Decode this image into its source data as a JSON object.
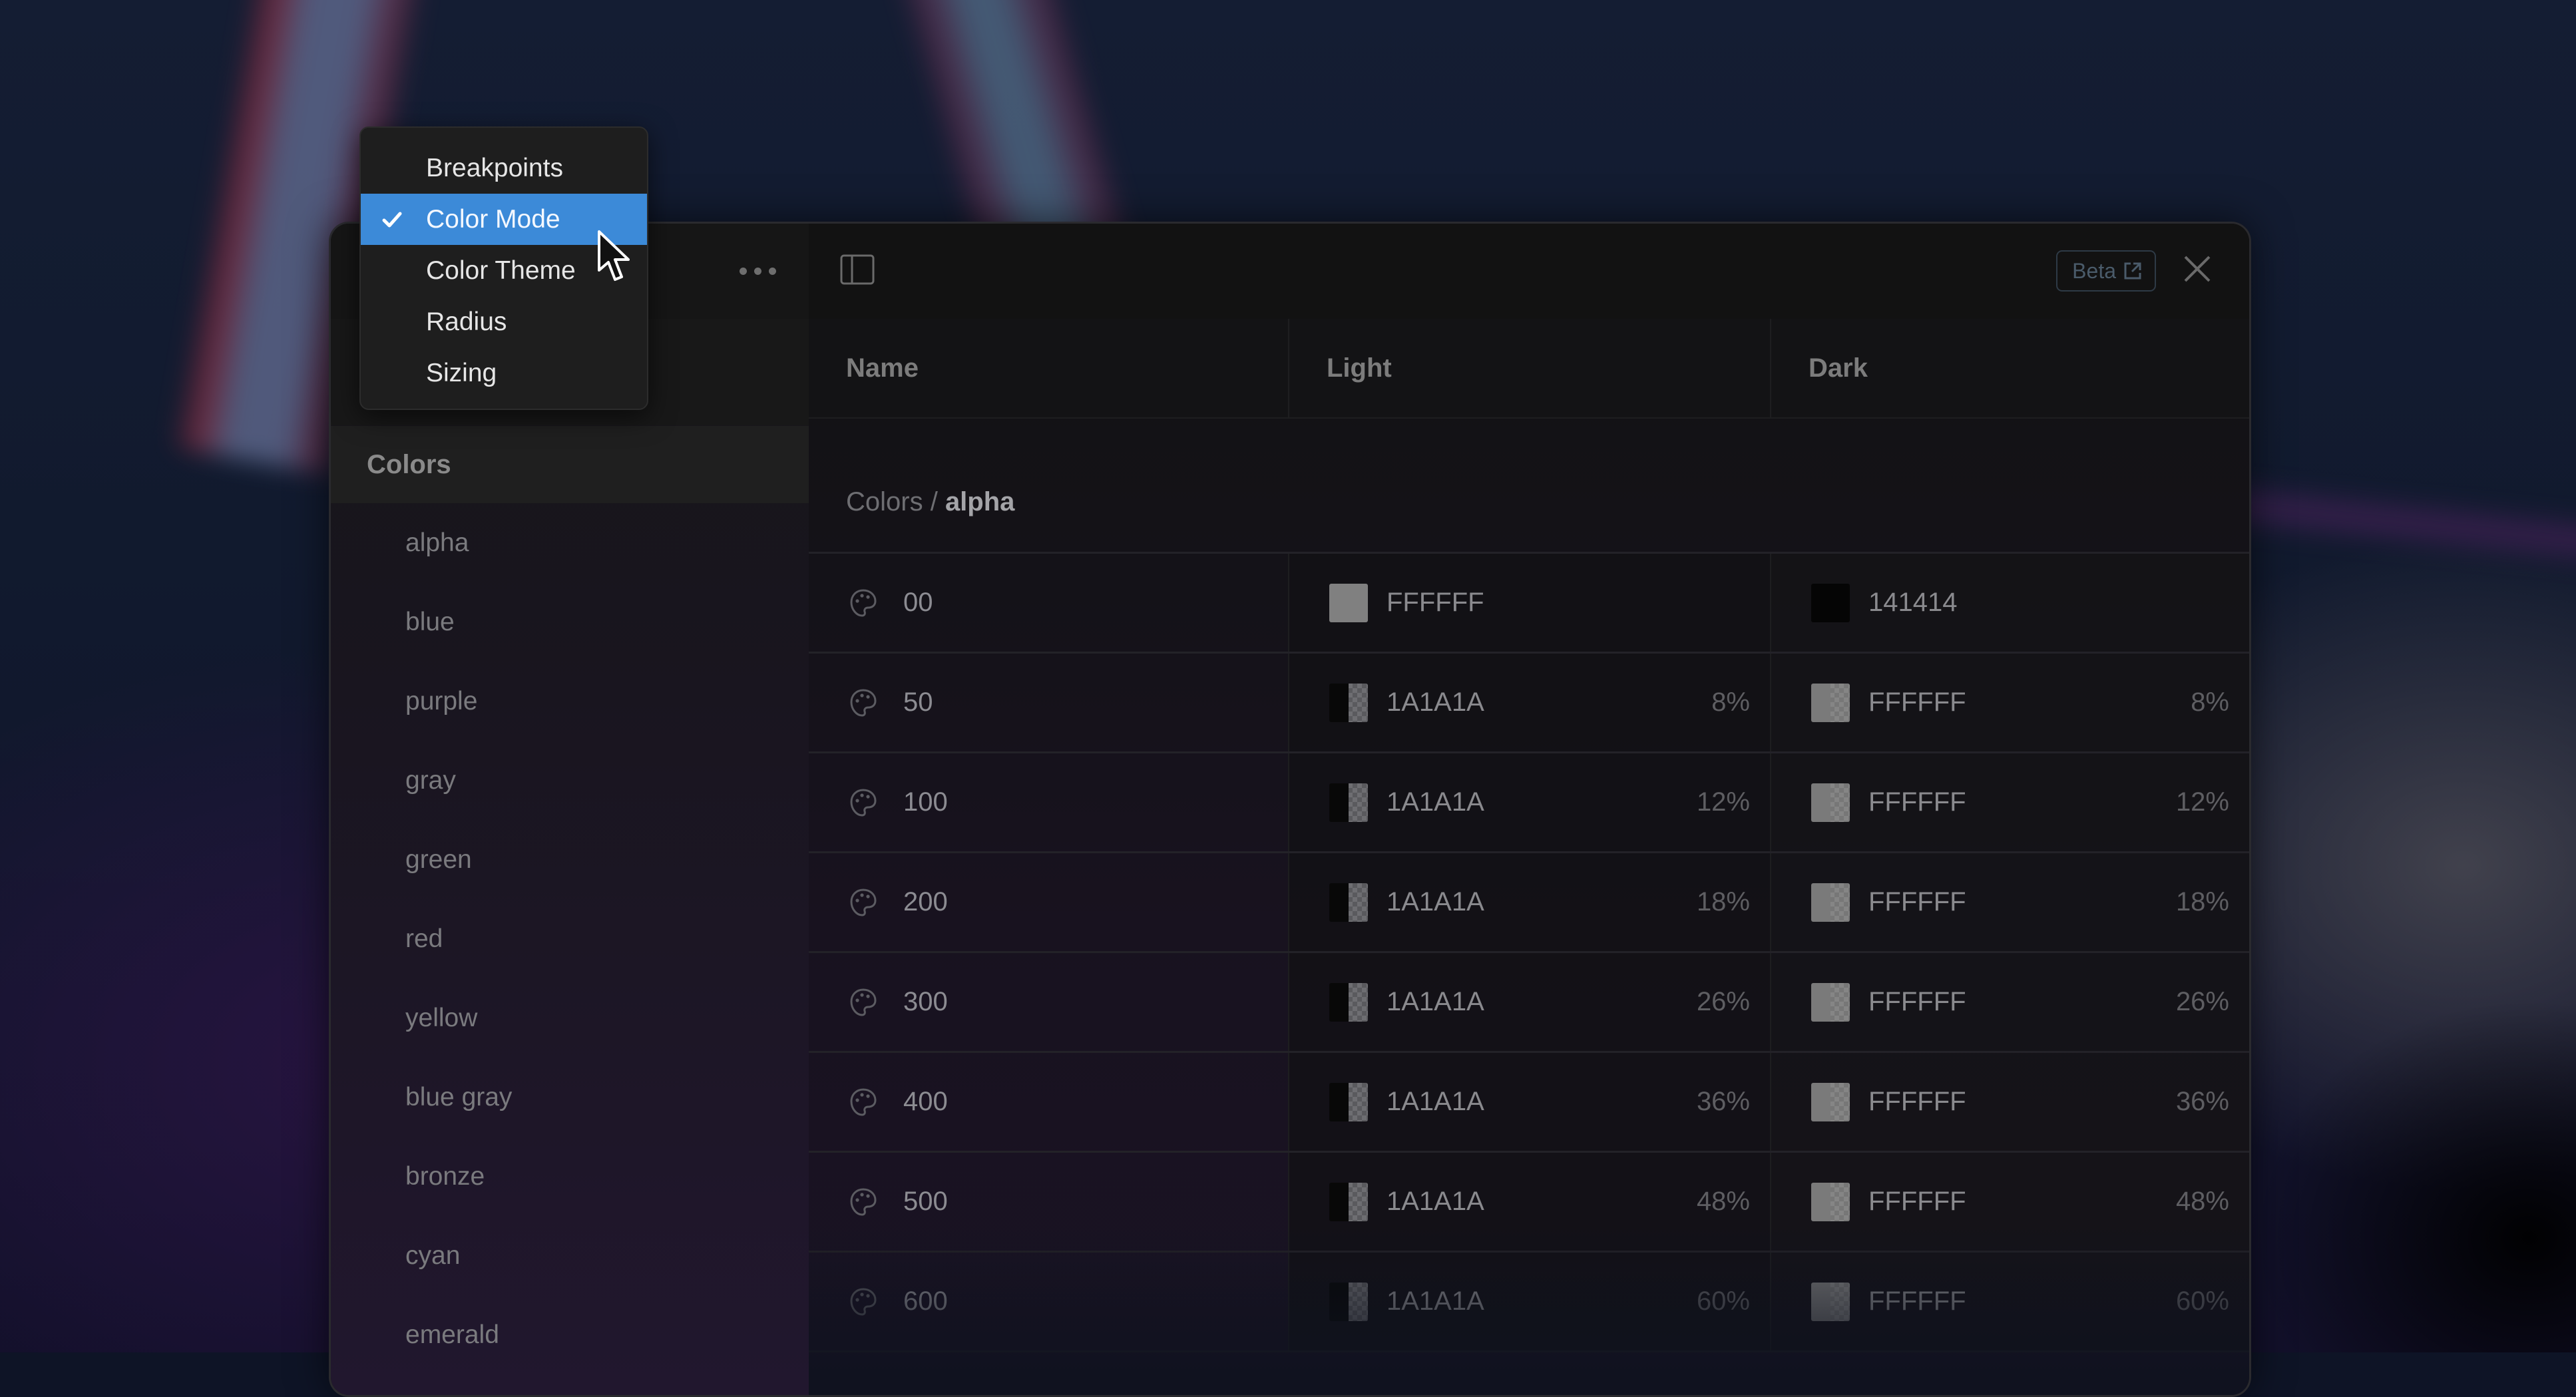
{
  "menu": {
    "items": [
      {
        "label": "Breakpoints",
        "selected": false
      },
      {
        "label": "Color Mode",
        "selected": true
      },
      {
        "label": "Color Theme",
        "selected": false
      },
      {
        "label": "Radius",
        "selected": false
      },
      {
        "label": "Sizing",
        "selected": false
      }
    ]
  },
  "header": {
    "more_icon": "ellipsis-icon",
    "sidebar_toggle_icon": "sidebar-panel-icon",
    "beta_label": "Beta",
    "beta_icon": "external-link-icon",
    "close_icon": "close-icon"
  },
  "sidebar": {
    "section_title": "Colors",
    "items": [
      "alpha",
      "blue",
      "purple",
      "gray",
      "green",
      "red",
      "yellow",
      "blue gray",
      "bronze",
      "cyan",
      "emerald"
    ]
  },
  "table": {
    "columns": [
      "Name",
      "Light",
      "Dark"
    ],
    "breadcrumb": {
      "parent": "Colors",
      "separator": " / ",
      "current": "alpha"
    },
    "row_icon": "palette-icon",
    "rows": [
      {
        "name": "00",
        "light": {
          "hex": "FFFFFF",
          "opacity": ""
        },
        "dark": {
          "hex": "141414",
          "opacity": ""
        }
      },
      {
        "name": "50",
        "light": {
          "hex": "1A1A1A",
          "opacity": "8%"
        },
        "dark": {
          "hex": "FFFFFF",
          "opacity": "8%"
        }
      },
      {
        "name": "100",
        "light": {
          "hex": "1A1A1A",
          "opacity": "12%"
        },
        "dark": {
          "hex": "FFFFFF",
          "opacity": "12%"
        }
      },
      {
        "name": "200",
        "light": {
          "hex": "1A1A1A",
          "opacity": "18%"
        },
        "dark": {
          "hex": "FFFFFF",
          "opacity": "18%"
        }
      },
      {
        "name": "300",
        "light": {
          "hex": "1A1A1A",
          "opacity": "26%"
        },
        "dark": {
          "hex": "FFFFFF",
          "opacity": "26%"
        }
      },
      {
        "name": "400",
        "light": {
          "hex": "1A1A1A",
          "opacity": "36%"
        },
        "dark": {
          "hex": "FFFFFF",
          "opacity": "36%"
        }
      },
      {
        "name": "500",
        "light": {
          "hex": "1A1A1A",
          "opacity": "48%"
        },
        "dark": {
          "hex": "FFFFFF",
          "opacity": "48%"
        }
      },
      {
        "name": "600",
        "light": {
          "hex": "1A1A1A",
          "opacity": "60%"
        },
        "dark": {
          "hex": "FFFFFF",
          "opacity": "60%"
        }
      }
    ]
  },
  "colors": {
    "menu_selected_bg": "#3C8AD8",
    "window_bg": "#121212",
    "beta_border": "#2E3A46"
  }
}
